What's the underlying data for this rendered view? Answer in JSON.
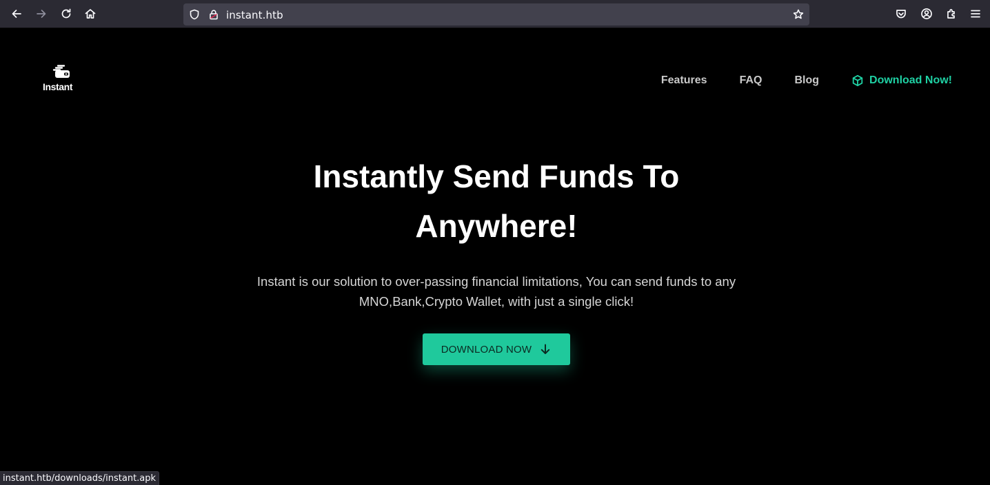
{
  "browser": {
    "url": "instant.htb",
    "icons": [
      "back-arrow-icon",
      "forward-arrow-icon",
      "reload-icon",
      "home-icon",
      "shield-icon",
      "lock-icon",
      "star-icon",
      "pocket-icon",
      "account-icon",
      "extensions-icon",
      "menu-icon"
    ]
  },
  "site": {
    "logo_text": "Instant",
    "nav": {
      "features": "Features",
      "faq": "FAQ",
      "blog": "Blog",
      "download": "Download Now!"
    },
    "hero": {
      "title_line1": "Instantly Send Funds To",
      "title_line2": "Anywhere!",
      "subtitle_line1": "Instant is our solution to over-passing financial limitations, You can send funds to any",
      "subtitle_line2": "MNO,Bank,Crypto Wallet, with just a single click!",
      "button_label": "DOWNLOAD NOW"
    },
    "colors": {
      "accent": "#1fd1a4",
      "button": "#1fc99c",
      "background": "#000000"
    }
  },
  "status_bar": {
    "text": "instant.htb/downloads/instant.apk"
  }
}
